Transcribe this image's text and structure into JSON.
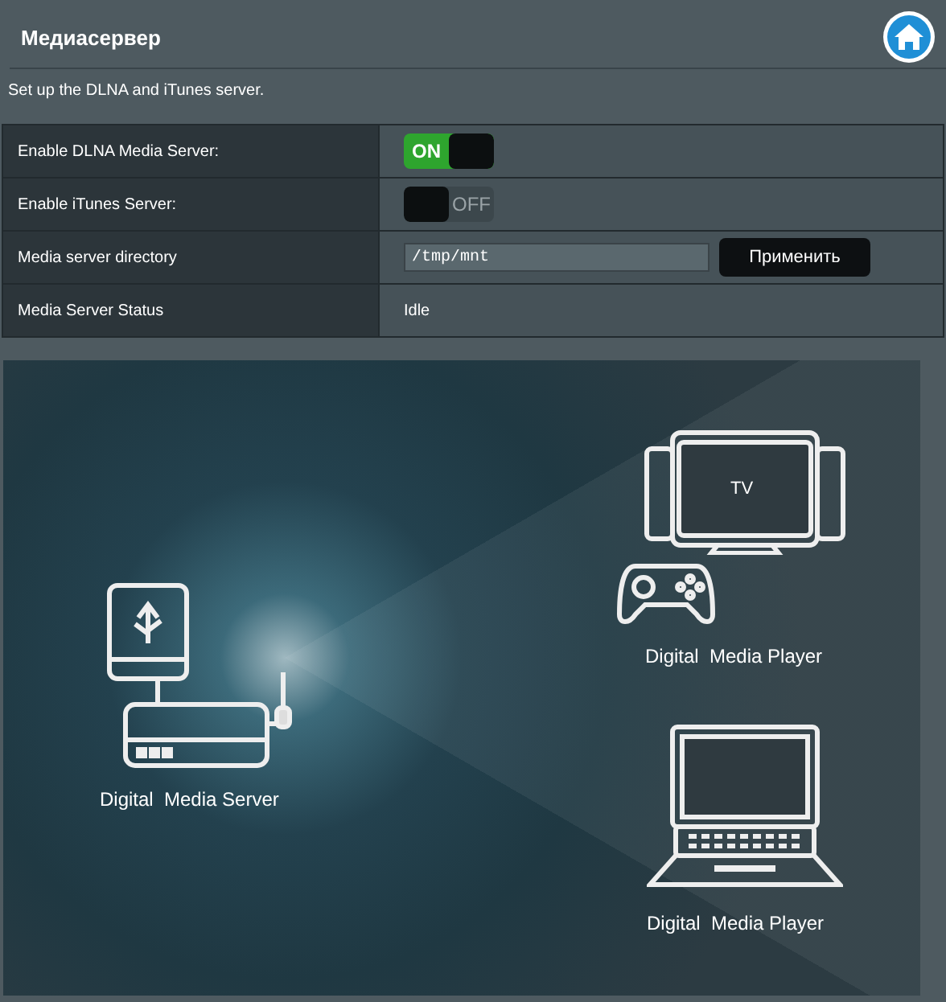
{
  "header": {
    "title": "Медиасервер",
    "description": "Set up the DLNA and iTunes server."
  },
  "rows": [
    {
      "label": "Enable DLNA Media Server:",
      "kind": "toggle",
      "on": true,
      "state_text": "ON"
    },
    {
      "label": "Enable iTunes Server:",
      "kind": "toggle",
      "on": false,
      "state_text": "OFF"
    },
    {
      "label": "Media server directory",
      "kind": "input",
      "value": "/tmp/mnt",
      "button": "Применить"
    },
    {
      "label": "Media Server Status",
      "kind": "text",
      "value": "Idle"
    }
  ],
  "diagram": {
    "server_label": "Digital  Media Server",
    "tv_text": "TV",
    "player_labels": [
      "Digital  Media Player",
      "Digital  Media Player"
    ]
  }
}
